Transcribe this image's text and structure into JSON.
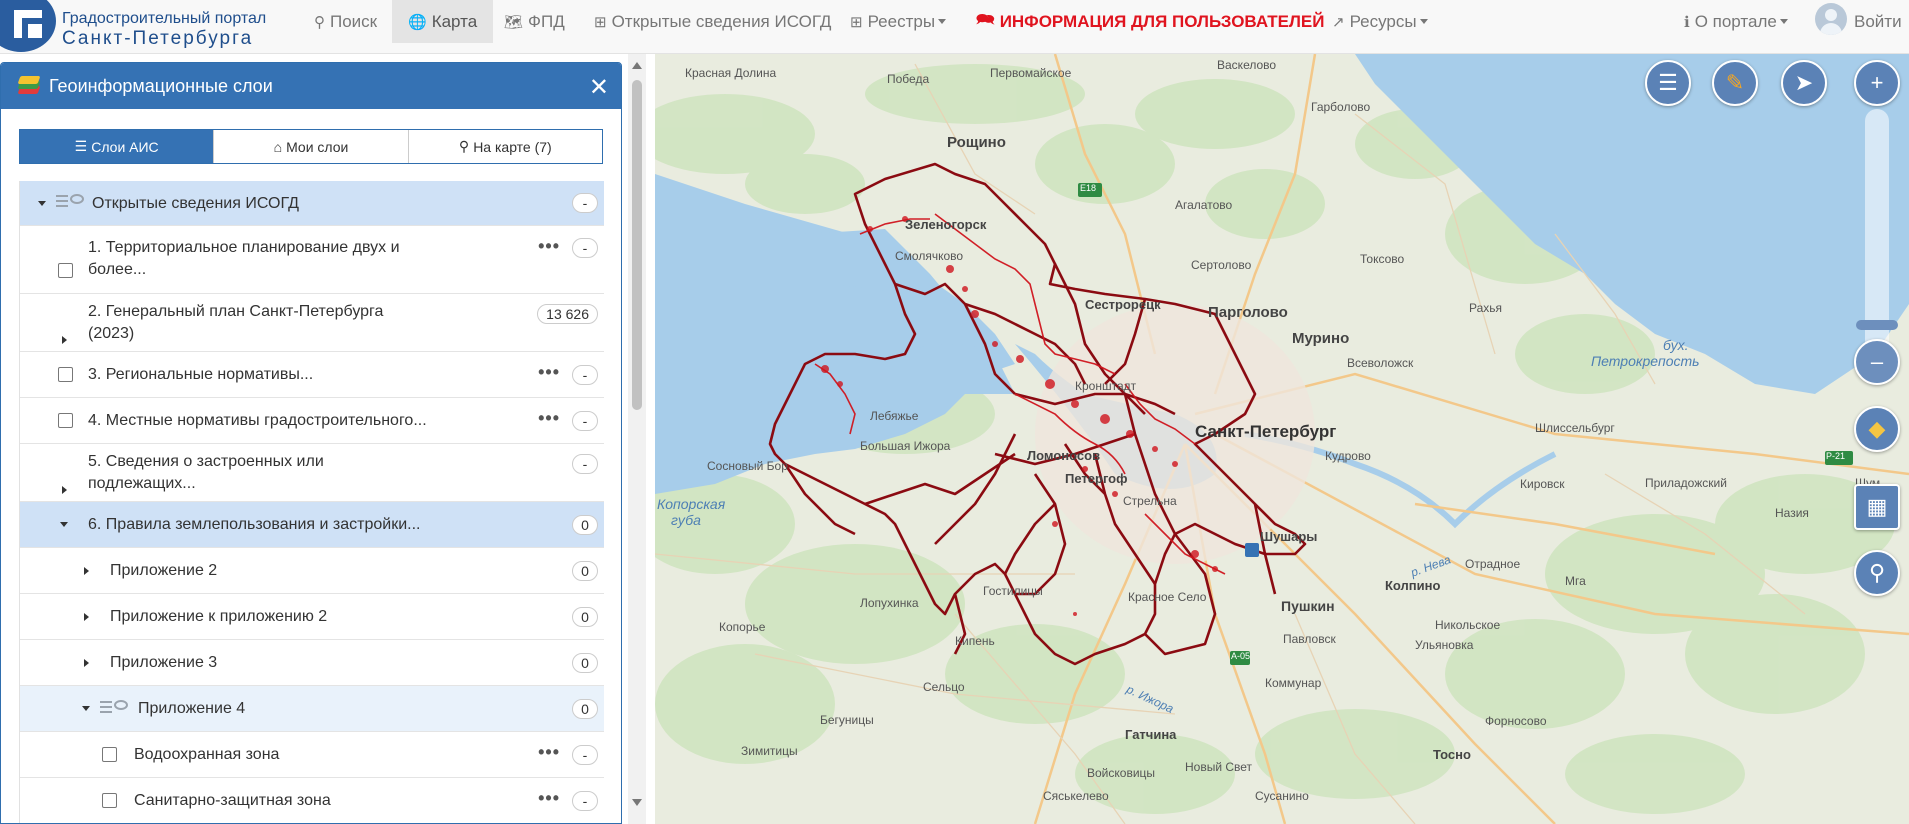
{
  "logo": {
    "line1": "Градостроительный портал",
    "line2": "Санкт-Петербурга"
  },
  "nav": {
    "search": "Поиск",
    "map": "Карта",
    "fpd": "ФПД",
    "open_isogd": "Открытые сведения ИСОГД",
    "registries": "Реестры",
    "info": "ИНФОРМАЦИЯ ДЛЯ ПОЛЬЗОВАТЕЛЕЙ",
    "resources": "Ресурсы",
    "about": "О портале",
    "login": "Войти"
  },
  "panel": {
    "title": "Геоинформационные слои",
    "tabs": [
      "Слои АИС",
      "Мои слои",
      "На карте (7)"
    ],
    "rows": [
      {
        "text": "Открытые сведения ИСОГД",
        "badge": "-"
      },
      {
        "text": "1. Территориальное планирование двух и",
        "text2": "более...",
        "badge": "-"
      },
      {
        "text": "2. Генеральный план Санкт-Петербурга",
        "text2": "(2023)",
        "badge": "13 626"
      },
      {
        "text": "3. Региональные нормативы...",
        "badge": "-"
      },
      {
        "text": "4. Местные нормативы градостроительного...",
        "badge": "-"
      },
      {
        "text": "5. Сведения о застроенных или",
        "text2": "подлежащих...",
        "badge": "-"
      },
      {
        "text": "6. Правила землепользования и застройки...",
        "badge": "0"
      },
      {
        "text": "Приложение 2",
        "badge": "0"
      },
      {
        "text": "Приложение к приложению 2",
        "badge": "0"
      },
      {
        "text": "Приложение 3",
        "badge": "0"
      },
      {
        "text": "Приложение 4",
        "badge": "0"
      },
      {
        "text": "Водоохранная зона",
        "badge": "-"
      },
      {
        "text": "Санитарно-защитная зона",
        "badge": "-"
      }
    ]
  },
  "map": {
    "labels": {
      "l1": "Красная Долина",
      "l2": "Победа",
      "l3": "Первомайское",
      "l4": "Васкелово",
      "l5": "Рощино",
      "l6": "Гарболово",
      "l7": "Агалатово",
      "l8": "Зеленогорск",
      "l9": "Смолячково",
      "l10": "Сертолово",
      "l11": "Токсово",
      "l12": "Сестрорецк",
      "l13": "Парголово",
      "l14": "Мурино",
      "l15": "Рахья",
      "l16": "Всеволожск",
      "l17": "бух.",
      "l18": "Петрокрепость",
      "l19": "Кронштадт",
      "l20": "Лебяжье",
      "l21": "Санкт-Петербург",
      "l22": "Шлиссельбург",
      "l23": "Большая Ижора",
      "l24": "Ломоносов",
      "l25": "Кудрово",
      "l26": "Сосновый Бор",
      "l27": "Петергоф",
      "l28": "Стрельна",
      "l29": "Копорская",
      "l30": "губа",
      "l31": "Кировск",
      "l32": "Приладожский",
      "l33": "Шум",
      "l34": "Назия",
      "l35": "Шушары",
      "l36": "Отрадное",
      "l37": "Колпино",
      "l38": "Мга",
      "l39": "Лопухинка",
      "l40": "Гостилицы",
      "l41": "Красное Село",
      "l42": "Пушкин",
      "l43": "Никольское",
      "l44": "Копорье",
      "l45": "Кипень",
      "l46": "Павловск",
      "l47": "Ульяновка",
      "l48": "Сельцо",
      "l49": "Коммунар",
      "l50": "Бегуницы",
      "l51": "Гатчина",
      "l52": "Форносово",
      "l53": "Зимитицы",
      "l54": "Войсковицы",
      "l55": "Новый Свет",
      "l56": "Тосно",
      "l57": "Сяськелево",
      "l58": "Сусанино",
      "l59": "р. Ижора",
      "l60": "р. Нева"
    },
    "shields": {
      "e18": "E18",
      "r21": "Р-21",
      "a05": "А-05"
    }
  }
}
